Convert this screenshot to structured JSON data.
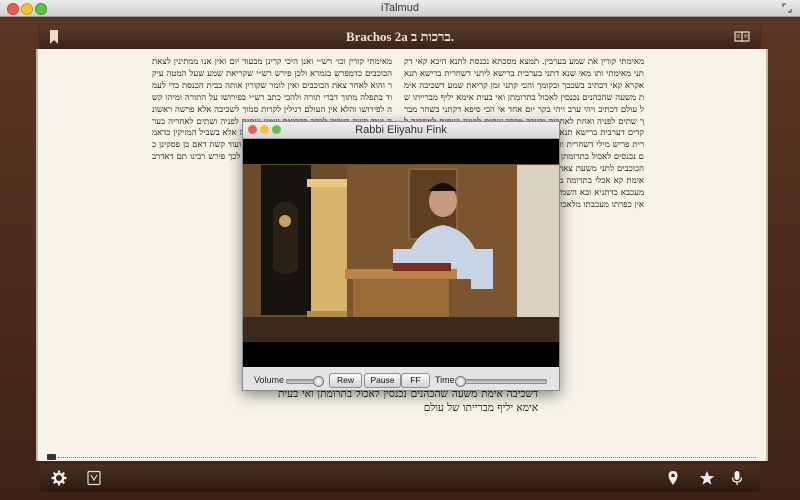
{
  "window": {
    "title": "iTalmud"
  },
  "bookbar": {
    "title": "Brachos 2a  ברכות ב."
  },
  "page": {
    "right_column": "מאימתי קורין את שמע בערבין. תמצא מסכתא נכנסת לתנא היכא קאי דקתני מאימתי ותו מאי שנא דתני בערבית ברישא ליתני דשחרית ברישא תנא אקרא קאי דכתיב בשכבך ובקומך והכי קתני זמן קריאת שמע דשכיבה אימת משעה שהכהנים נכנסין לאכול בתרומתן ואי בעית אימא יליף מברייתו של עולם דכתיב ויהי ערב ויהי בקר יום אחד אי הכי סיפא דקתני בשחר מברך שתים לפניה ואחת לאחריה ובערב מברך שתים לפניה ושתים לאחריה לקדים דערבית ברישא תנא פתח בערבית והדר תני בשחרית עד דקאי בשחרית פריש מילי דשחרית והדר פריש מילי דערבית אמר מר משעה שהכהנים נכנסים לאכול בתרומתן מכדי כהנים אימת קא אכלי תרומה משעת צאת הכוכבים לתני משעת צאת הכוכבים מלתא אגב אורחיה קמשמע לן כהנים אימת קא אכלי בתרומה משעת צאת הכוכבים והא קמשמע לן דכפרה לא מעכבא כדתניא ובא השמש וטהר ביאת שמשו מעכבתו מלאכול בתרומה ואין כפרתו מעכבתו מלאכול בתרומה",
    "left_column": "מאימתי קורין וכו׳ רש״י ואנן היכי קרינן מבעוד יום ואין אנו ממתינין לצאת הכוכבים כדמפרש בגמרא ולכן פירש רש״י שקריאת שמע שעל המטה עיקר והוא לאחר צאת הכוכבים ואין לומר שקורין אותה בבית הכנסת כדי לעמוד בתפלה מתוך דברי תורה ולהכי כתב רש״י בפירושו על התורה ומיהו קשה לפירושו והלא אין העולם רגילין לקרות סמוך לשכיבה אלא פרשה ראשונה ועוד קשה דצריך לברך בקריאת שמע שתים לפניה ושתים לאחריה בערבית ועוד דאותה קריאת שמע סמוך למטה אינה אלא בשביל המזיקין כדאמר בגמרא ואם תלמיד חכם הוא אינו צריך לכך ועוד קשה דאם כן פסקינן כרבי יהושע בן לוי דאמר תפלות באמצע תקנום לכך פירש רבינו תם דאדרבה קריאת שמע של בית הכנסת עיקר",
    "center_text": "מאימתי ותו מאי שנא דתני בערבית ברישא ליתני דשחרית ברישא תנא אקרא קאי דכתיב בשכבך ובקומך והכי קתני זמן קריאת שמע דשכיבה אימת משעה שהכהנים נכנסין לאכול בתרומתן ואי בעית אימא יליף מברייתו של עולם"
  },
  "video_window": {
    "title": "Rabbi Eliyahu Fink",
    "volume_label": "Volume",
    "volume_level": 0.9,
    "rew_label": "Rew",
    "pause_label": "Pause",
    "ff_label": "FF",
    "time_label": "Time",
    "time_position": 0.0
  },
  "toolbar": {
    "icons": [
      "gear-icon",
      "bookmark-list-icon",
      "location-pin-icon",
      "star-icon",
      "microphone-icon"
    ]
  },
  "colors": {
    "frame": "#4a2b1c",
    "page": "#f7f3ea",
    "toolbar": "#3a2419"
  }
}
